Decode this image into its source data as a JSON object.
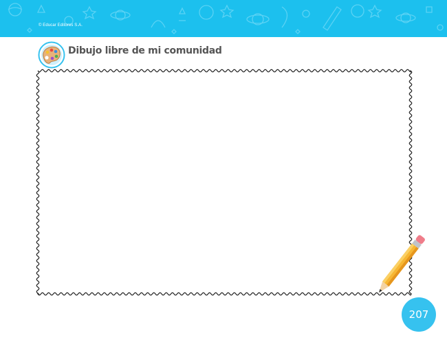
{
  "header": {
    "copyright": "© Educar Editores S.A.",
    "band_color": "#1cc0ee"
  },
  "section": {
    "icon": "paint-palette-icon",
    "title": "Dibujo libre de mi comunidad"
  },
  "drawing_area": {
    "border_style": "wavy",
    "decoration_icon": "pencil-icon"
  },
  "footer": {
    "page_number": "207",
    "badge_color": "#36c2ef"
  }
}
